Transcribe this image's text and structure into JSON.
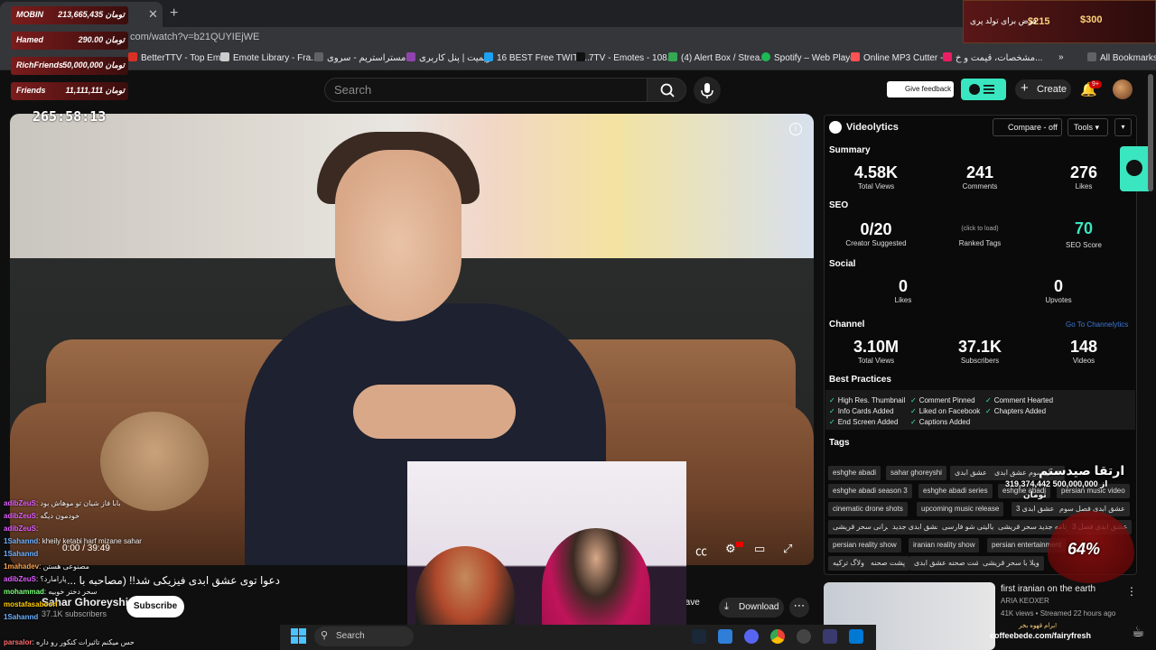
{
  "browser": {
    "url": "com/watch?v=b21QUYIEjWE",
    "bookmarks": [
      "BetterTTV - Top Em...",
      "Emote Library - Fra...",
      "مستراستریم - سروی...",
      "ریمیت | پنل کاربری",
      "16 BEST Free TWITC...",
      "7TV - Emotes - 108...",
      "(4) Alert Box / Strea...",
      "Spotify – Web Player",
      "Online MP3 Cutter -...",
      "مشخصات، قیمت و خ...",
      "All Bookmarks"
    ]
  },
  "header": {
    "search_placeholder": "Search",
    "feedback_label": "Give feedback",
    "create_label": "Create",
    "notif_count": "9+"
  },
  "video": {
    "current_time": "0:00 / 39:49",
    "overlay_timer": "265:58:13",
    "title": "دعوا توی عشق ابدی فیزیکی شد!! (مصاحبه با ...",
    "channel_name": "Sahar Ghoreyshi",
    "channel_subs": "37.1K subscribers",
    "subscribe_label": "Subscribe",
    "save_label": "Save",
    "download_label": "Download"
  },
  "videolytics": {
    "title": "Videolytics",
    "compare_label": "Compare - off",
    "tools_label": "Tools",
    "summary": {
      "heading": "Summary",
      "views": "4.58K",
      "views_label": "Total Views",
      "comments": "241",
      "comments_label": "Comments",
      "likes": "276",
      "likes_label": "Likes"
    },
    "seo": {
      "heading": "SEO",
      "creator_suggested": "0/20",
      "creator_label": "Creator Suggested",
      "ranked_hint": "(click to load)",
      "ranked_label": "Ranked Tags",
      "score": "70",
      "score_label": "SEO Score"
    },
    "social": {
      "heading": "Social",
      "likes": "0",
      "likes_label": "Likes",
      "upvotes": "0",
      "upvotes_label": "Upvotes"
    },
    "channel": {
      "heading": "Channel",
      "link": "Go To Channelytics",
      "views": "3.10M",
      "views_label": "Total Views",
      "subs": "37.1K",
      "subs_label": "Subscribers",
      "videos": "148",
      "videos_label": "Videos"
    },
    "best_practices": {
      "heading": "Best Practices",
      "items": [
        "High Res. Thumbnail",
        "Comment Pinned",
        "Comment Hearted",
        "Info Cards Added",
        "Liked on Facebook",
        "Chapters Added",
        "End Screen Added",
        "Captions Added"
      ]
    },
    "tags": {
      "heading": "Tags",
      "items": [
        "eshghe abadi",
        "sahar ghoreyshi",
        "عشق ابدی",
        "فصل سوم عشق ابدی",
        "eshghe abadi season 3",
        "eshghe abadi series",
        "eshghe abadi",
        "persian music video",
        "cinematic drone shots",
        "upcoming music release",
        "عشق ابدی 3",
        "عشق ابدی فصل سوم",
        "ایرانی سحر قریشی",
        "عشق ابدی جدید",
        "ریالیتی شو فارسی",
        "برنامه جدید سحر قریشی",
        "عشق ابدی فصل 3",
        "persian reality show",
        "iranian reality show",
        "persian entertainment",
        "ولاگ ترکیه",
        "پشت صحنه",
        "پشت صحنه عشق ابدی",
        "ویلا با سحر قریشی"
      ]
    }
  },
  "suggested": {
    "title": "first iranian on the earth",
    "channel": "ARIA KEOXER",
    "meta": "41K views • Streamed 22 hours ago"
  },
  "stream": {
    "leaderboard": [
      {
        "name": "MOBIN",
        "amount": "213,665,435 تومان"
      },
      {
        "name": "Hamed",
        "amount": "290.00 تومان"
      },
      {
        "name": "RichFriends",
        "amount": "50,000,000 تومان"
      },
      {
        "name": "Friends",
        "amount": "11,111,111 تومان"
      }
    ],
    "donation": {
      "price1": "$300",
      "price2": "$215",
      "text": "قرض برای تولد پری"
    },
    "goal": {
      "title": "ارتقا صیدستم",
      "amount": "319,374,442 از 500,000,000",
      "unit": "تومان",
      "percent": "64%"
    },
    "sponsor": {
      "url": "coffeebede.com/fairyfresh",
      "slogan": "برام قهوه بخر!"
    },
    "chat": [
      {
        "user": "adibZeuS",
        "msg": "بابا فاز شیان تو موهاش بود",
        "color": "#e05cff"
      },
      {
        "user": "adibZeuS",
        "msg": "خودمون دیگه",
        "color": "#e05cff"
      },
      {
        "user": "adibZeuS",
        "msg": ":",
        "color": "#e05cff"
      },
      {
        "user": "1Sahannd",
        "msg": "kheily ketabi harf mizane sahar",
        "color": "#6ab0ff"
      },
      {
        "user": "1Sahannd",
        "msg": "",
        "color": "#6ab0ff"
      },
      {
        "user": "1mahadev",
        "msg": "مصنوعی هستن",
        "color": "#ffa24c"
      },
      {
        "user": "adibZeuS",
        "msg": "پارامارد؟",
        "color": "#e05cff"
      },
      {
        "user": "mohammad",
        "msg": "سحر دختر خوبیه",
        "color": "#7cff7c"
      },
      {
        "user": "mostafasaboori",
        "msg": "",
        "color": "#ffcc00"
      },
      {
        "user": "1Sahannd",
        "msg": "",
        "color": "#6ab0ff"
      },
      {
        "user": "parsalor",
        "msg": "حس میکنم تاثیرات کنکور رو داره",
        "color": "#ff6b6b"
      }
    ]
  },
  "taskbar": {
    "search_label": "Search"
  }
}
